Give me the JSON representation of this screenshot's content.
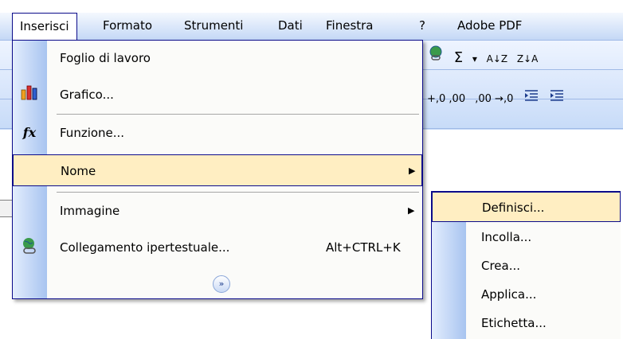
{
  "menubar": {
    "items": [
      {
        "label": "Inserisci",
        "open": true
      },
      {
        "label": "Formato"
      },
      {
        "label": "Strumenti"
      },
      {
        "label": "Dati"
      },
      {
        "label": "Finestra"
      },
      {
        "label": "?"
      },
      {
        "label": "Adobe PDF"
      }
    ]
  },
  "menu": {
    "items": [
      {
        "label": "Foglio di lavoro",
        "icon": "none"
      },
      {
        "label": "Grafico...",
        "icon": "chart-icon"
      },
      {
        "label": "Funzione...",
        "icon": "function-icon",
        "icon_glyph": "fx"
      },
      {
        "label": "Nome",
        "submenu": true,
        "highlighted": true
      },
      {
        "label": "Immagine",
        "submenu": true
      },
      {
        "label": "Collegamento ipertestuale...",
        "icon": "hyperlink-icon",
        "shortcut": "Alt+CTRL+K"
      }
    ],
    "expand_icon": "double-chevron-down-icon"
  },
  "submenu": {
    "items": [
      {
        "label": "Definisci...",
        "highlighted": true
      },
      {
        "label": "Incolla..."
      },
      {
        "label": "Crea..."
      },
      {
        "label": "Applica..."
      },
      {
        "label": "Etichetta..."
      }
    ]
  },
  "toolbar": {
    "sigma": "Σ",
    "dropdown": "▾",
    "sort_asc": "A↓Z",
    "sort_desc": "Z↓A",
    "decimal_more": "+,0 ,00",
    "decimal_less": ",00 →,0"
  },
  "colors": {
    "highlight": "#ffeec2",
    "border": "#0b0b8a",
    "gutter": "#a8c4f0"
  }
}
